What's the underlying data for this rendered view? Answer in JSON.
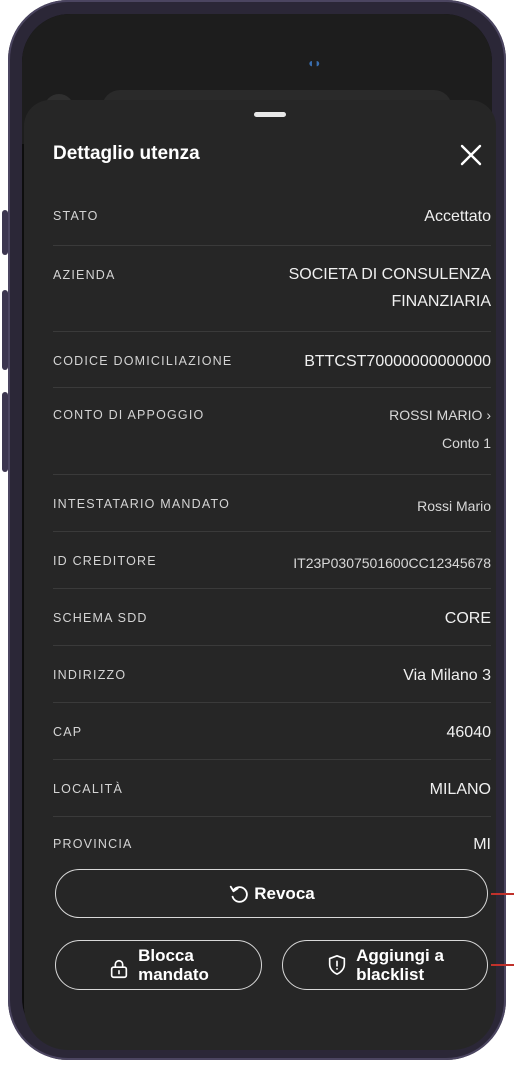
{
  "sheet": {
    "title": "Dettaglio utenza"
  },
  "rows": [
    {
      "label": "STATO",
      "value": "Accettato"
    },
    {
      "label": "AZIENDA",
      "value_lines": [
        "SOCIETA DI CONSULENZA",
        "FINANZIARIA"
      ]
    },
    {
      "label": "CODICE DOMICILIAZIONE",
      "value": "BTTCST70000000000000"
    },
    {
      "label": "CONTO DI APPOGGIO",
      "value_lines": [
        "ROSSI MARIO ›",
        "Conto 1"
      ]
    },
    {
      "label": "INTESTATARIO MANDATO",
      "value": "Rossi Mario"
    },
    {
      "label": "ID CREDITORE",
      "value": "IT23P0307501600CC12345678"
    },
    {
      "label": "SCHEMA SDD",
      "value": "CORE"
    },
    {
      "label": "INDIRIZZO",
      "value": "Via Milano 3"
    },
    {
      "label": "CAP",
      "value": "46040"
    },
    {
      "label": "LOCALITÀ",
      "value": "MILANO"
    },
    {
      "label": "PROVINCIA",
      "value": "MI"
    }
  ],
  "actions": {
    "revoca_label": "Revoca",
    "blocca_line1": "Blocca",
    "blocca_line2": "mandato",
    "blacklist_line1": "Aggiungi a",
    "blacklist_line2": "blacklist"
  },
  "icons": {
    "close": "close-icon",
    "revoca": "undo-icon",
    "blocca": "lock-icon",
    "blacklist": "shield-icon"
  },
  "colors": {
    "sheet_bg": "#262626",
    "text": "#ffffff",
    "divider": "#3a3a3a",
    "annotation": "#c0312b"
  }
}
